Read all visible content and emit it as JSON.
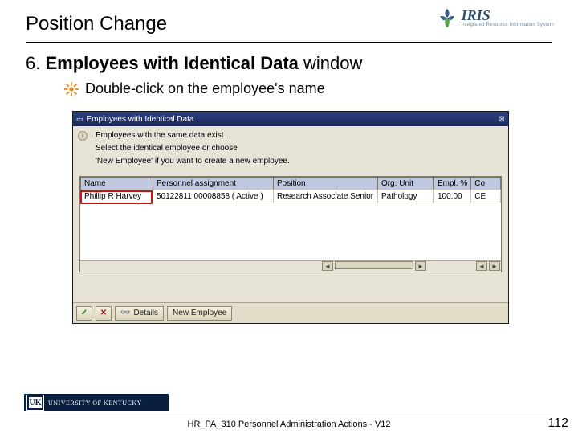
{
  "header": {
    "title": "Position Change",
    "logo": {
      "name": "IRIS",
      "tagline": "Integrated Resource Information System"
    }
  },
  "step": {
    "number": "6.",
    "bold_label": "Employees with Identical Data",
    "suffix": " window"
  },
  "sub_bullet": "Double-click on the employee's name",
  "sap": {
    "window_title": "Employees with Identical Data",
    "info_line1": "Employees with the same data exist",
    "info_line2": "Select the identical employee or choose",
    "info_line3": "'New Employee' if you want to create a new employee.",
    "columns": [
      "Name",
      "Personnel assignment",
      "Position",
      "Org. Unit",
      "Empl. %",
      "Co"
    ],
    "row": {
      "name": "Phillip R Harvey",
      "assignment": "50122811 00008858 ( Active )",
      "position": "Research Associate Senior",
      "org_unit": "Pathology",
      "pct": "100.00",
      "co": "CE"
    },
    "toolbar": {
      "ok_icon": "check",
      "cancel_icon": "x",
      "details_label": "Details",
      "new_emp_label": "New Employee"
    }
  },
  "footer": {
    "uk_label": "UNIVERSITY OF KENTUCKY",
    "center": "HR_PA_310 Personnel Administration Actions - V12",
    "page": "112"
  }
}
